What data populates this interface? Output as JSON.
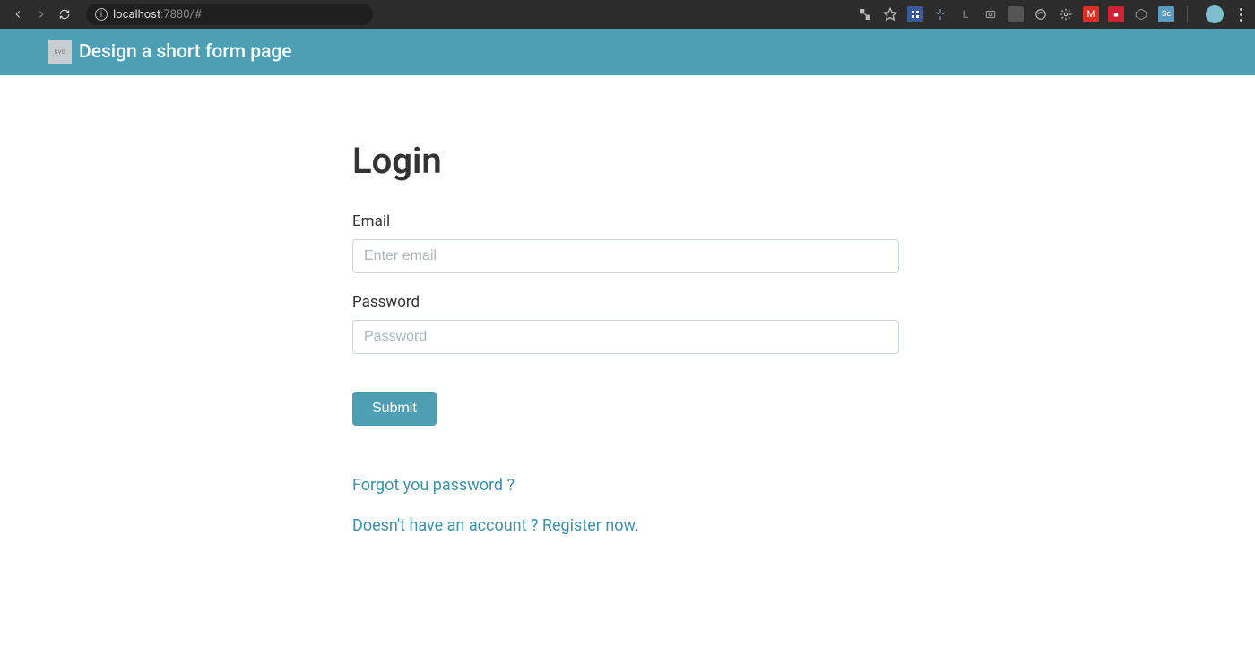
{
  "browser": {
    "url_host": "localhost",
    "url_port_path": ":7880/#"
  },
  "header": {
    "brand_label": "SVG",
    "title": "Design a short form page"
  },
  "form": {
    "heading": "Login",
    "email": {
      "label": "Email",
      "placeholder": "Enter email",
      "value": ""
    },
    "password": {
      "label": "Password",
      "placeholder": "Password",
      "value": ""
    },
    "submit_label": "Submit"
  },
  "links": {
    "forgot": "Forgot you password ?",
    "register": "Doesn't have an account ? Register now."
  }
}
